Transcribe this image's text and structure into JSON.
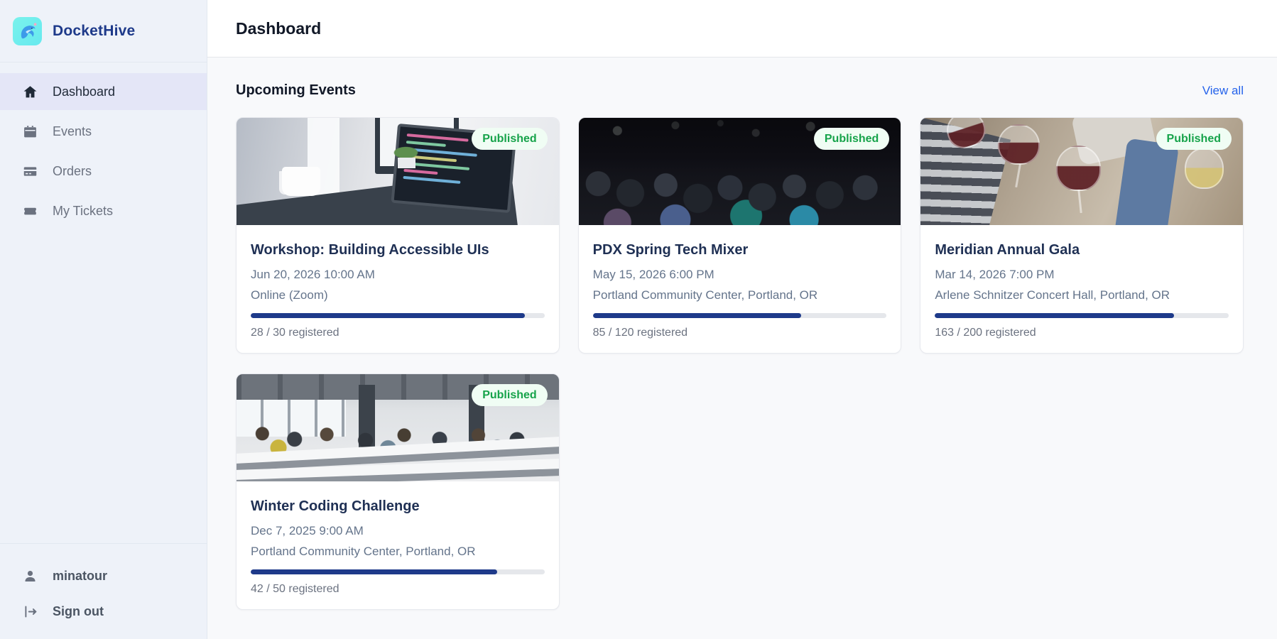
{
  "app": {
    "name": "DocketHive"
  },
  "colors": {
    "brand_navy": "#1e3a8a",
    "sidebar_bg": "#eef2f9",
    "active_item_bg": "#e4e6f7",
    "accent_link": "#2563eb",
    "progress_fill": "#1e3a8a",
    "badge_green": "#16a34a",
    "badge_bg": "#f0fdf4",
    "logo_aqua": "#79f2ec"
  },
  "sidebar": {
    "nav": [
      {
        "label": "Dashboard",
        "icon": "home-icon",
        "active": true
      },
      {
        "label": "Events",
        "icon": "calendar-icon",
        "active": false
      },
      {
        "label": "Orders",
        "icon": "credit-card-icon",
        "active": false
      },
      {
        "label": "My Tickets",
        "icon": "ticket-icon",
        "active": false
      }
    ],
    "footer": {
      "username": "minatour",
      "signout_label": "Sign out"
    }
  },
  "header": {
    "title": "Dashboard"
  },
  "main": {
    "section_title": "Upcoming Events",
    "view_all_label": "View all",
    "cards": [
      {
        "title": "Workshop: Building Accessible UIs",
        "badge": "Published",
        "datetime": "Jun 20, 2026 10:00 AM",
        "location": "Online (Zoom)",
        "registered": 28,
        "capacity": 30,
        "registered_label": "28 / 30 registered",
        "progress_pct": 93.3,
        "image": "workshop-desk-laptop-photo"
      },
      {
        "title": "PDX Spring Tech Mixer",
        "badge": "Published",
        "datetime": "May 15, 2026 6:00 PM",
        "location": "Portland Community Center, Portland, OR",
        "registered": 85,
        "capacity": 120,
        "registered_label": "85 / 120 registered",
        "progress_pct": 70.8,
        "image": "conference-audience-photo"
      },
      {
        "title": "Meridian Annual Gala",
        "badge": "Published",
        "datetime": "Mar 14, 2026 7:00 PM",
        "location": "Arlene Schnitzer Concert Hall, Portland, OR",
        "registered": 163,
        "capacity": 200,
        "registered_label": "163 / 200 registered",
        "progress_pct": 81.5,
        "image": "wine-toast-photo"
      },
      {
        "title": "Winter Coding Challenge",
        "badge": "Published",
        "datetime": "Dec 7, 2025 9:00 AM",
        "location": "Portland Community Center, Portland, OR",
        "registered": 42,
        "capacity": 50,
        "registered_label": "42 / 50 registered",
        "progress_pct": 84,
        "image": "open-office-hackathon-photo"
      }
    ]
  }
}
